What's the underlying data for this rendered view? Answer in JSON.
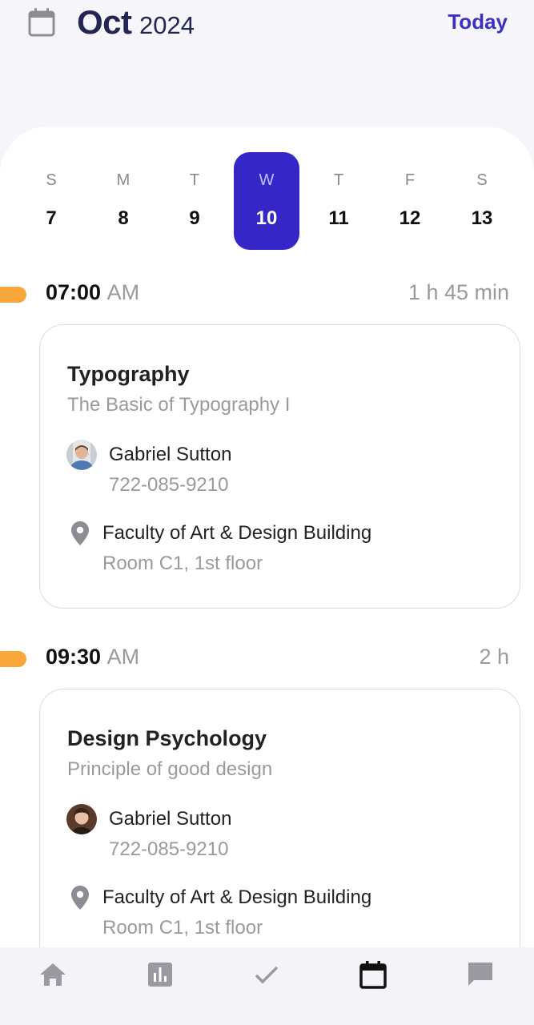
{
  "header": {
    "month": "Oct",
    "year": "2024",
    "today_label": "Today"
  },
  "week": {
    "days": [
      {
        "name": "S",
        "number": "7"
      },
      {
        "name": "M",
        "number": "8"
      },
      {
        "name": "T",
        "number": "9"
      },
      {
        "name": "W",
        "number": "10"
      },
      {
        "name": "T",
        "number": "11"
      },
      {
        "name": "F",
        "number": "12"
      },
      {
        "name": "S",
        "number": "13"
      }
    ],
    "selected_index": 3
  },
  "events": [
    {
      "time": "07:00",
      "ampm": "AM",
      "duration": "1 h 45 min",
      "title": "Typography",
      "subtitle": "The Basic of Typography I",
      "person_name": "Gabriel Sutton",
      "person_phone": "722-085-9210",
      "location": "Faculty of Art & Design Building",
      "room": "Room C1, 1st floor"
    },
    {
      "time": "09:30",
      "ampm": "AM",
      "duration": "2 h",
      "title": "Design Psychology",
      "subtitle": "Principle of good design",
      "person_name": "Gabriel Sutton",
      "person_phone": "722-085-9210",
      "location": "Faculty of Art & Design Building",
      "room": "Room C1, 1st floor"
    }
  ],
  "nav": {
    "items": [
      "home-icon",
      "stats-icon",
      "check-icon",
      "calendar-icon",
      "chat-icon"
    ],
    "active": "calendar-icon"
  },
  "colors": {
    "accent": "#3526c7",
    "today_link": "#3a30c4",
    "time_marker": "#f8a83a",
    "header_text": "#222652"
  }
}
